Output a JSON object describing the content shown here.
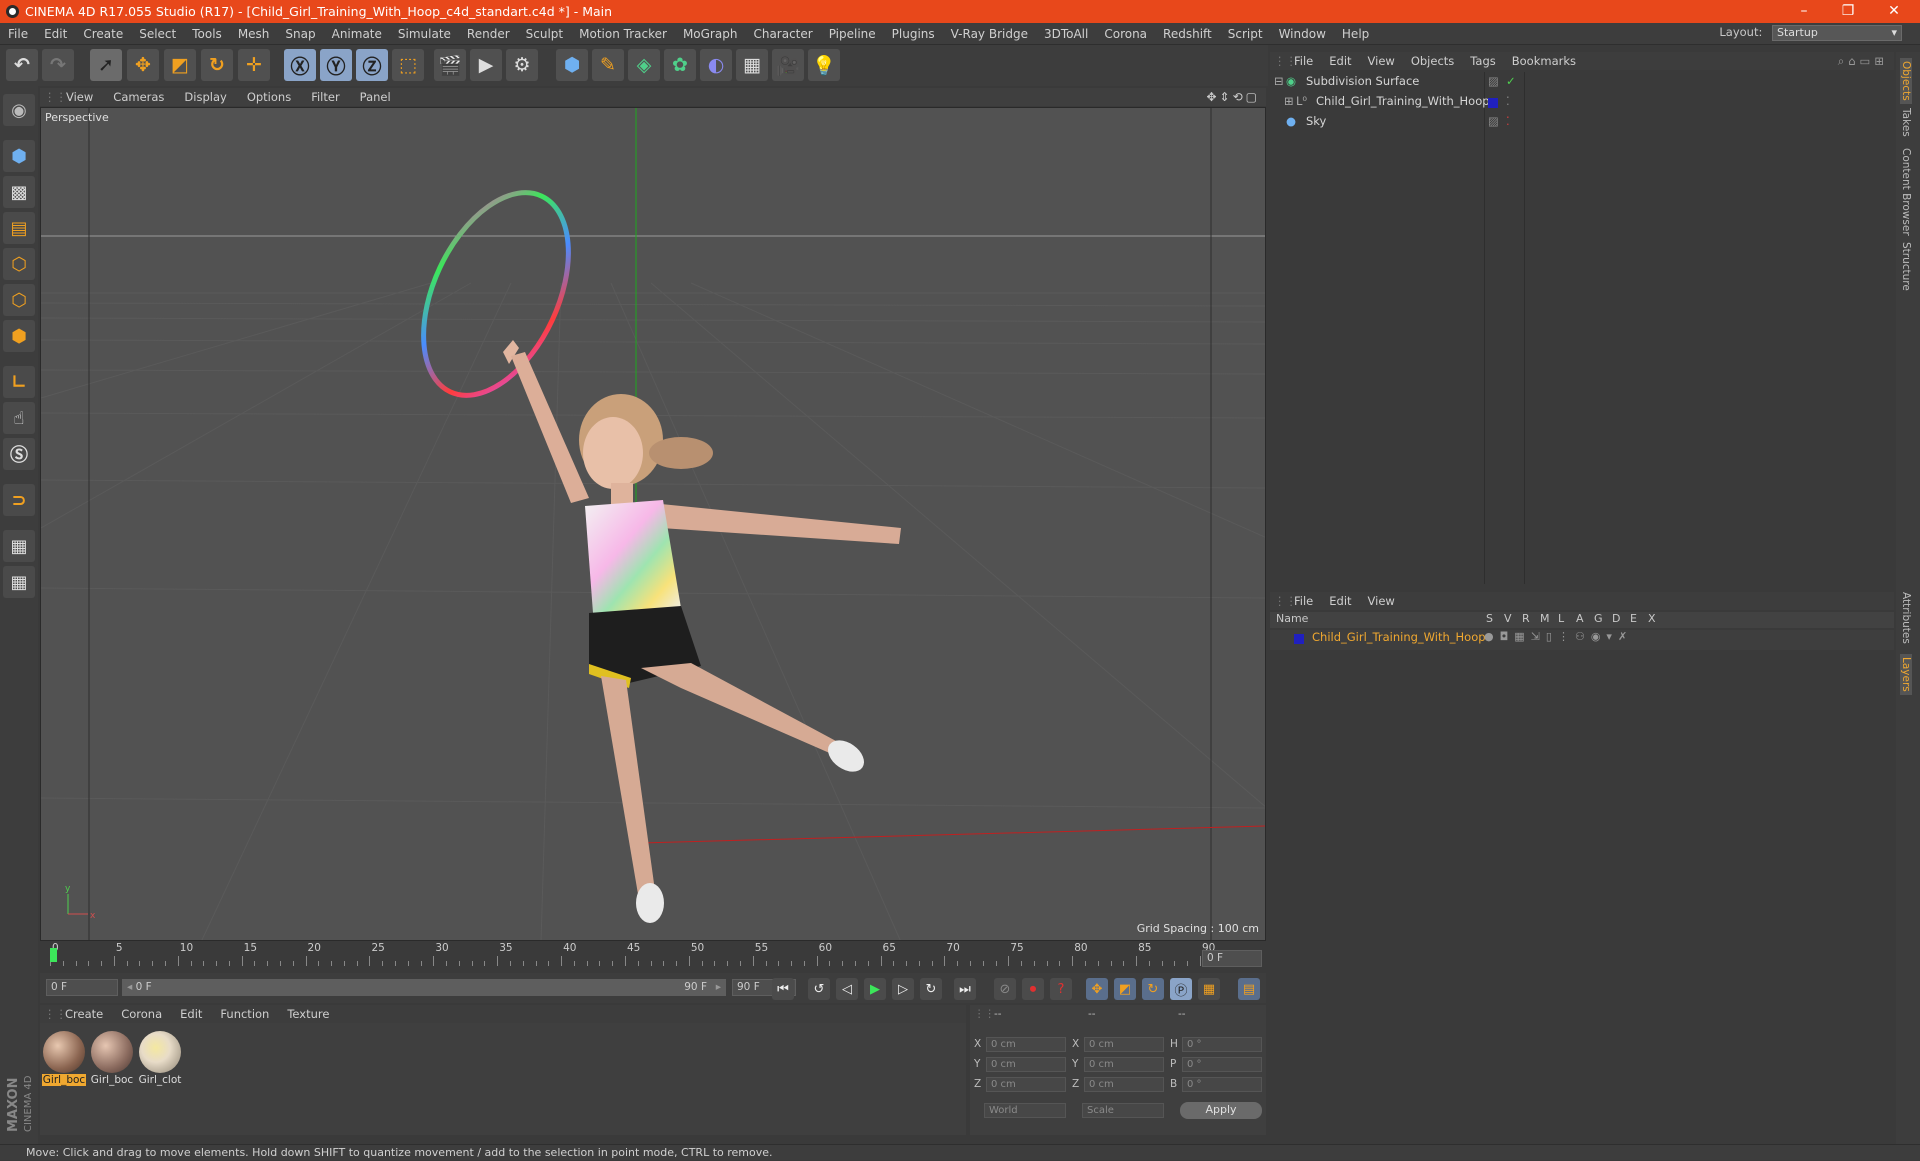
{
  "window": {
    "title": "CINEMA 4D R17.055 Studio (R17) - [Child_Girl_Training_With_Hoop_c4d_standart.c4d *] - Main",
    "controls": [
      "–",
      "❐",
      "✕"
    ]
  },
  "menubar": {
    "items": [
      "File",
      "Edit",
      "Create",
      "Select",
      "Tools",
      "Mesh",
      "Snap",
      "Animate",
      "Simulate",
      "Render",
      "Sculpt",
      "Motion Tracker",
      "MoGraph",
      "Character",
      "Pipeline",
      "Plugins",
      "V-Ray Bridge",
      "3DToAll",
      "Corona",
      "Redshift",
      "Script",
      "Window",
      "Help"
    ],
    "layout_label": "Layout:",
    "layout_value": "Startup"
  },
  "viewport": {
    "menu": [
      "View",
      "Cameras",
      "Display",
      "Options",
      "Filter",
      "Panel"
    ],
    "label": "Perspective",
    "grid_spacing": "Grid Spacing : 100 cm"
  },
  "timeline": {
    "ticks": [
      "0",
      "5",
      "10",
      "15",
      "20",
      "25",
      "30",
      "35",
      "40",
      "45",
      "50",
      "55",
      "60",
      "65",
      "70",
      "75",
      "80",
      "85",
      "90"
    ],
    "current_frame": "0 F"
  },
  "transport": {
    "start": "0 F",
    "range_start": "0 F",
    "range_end": "90 F",
    "end": "90 F"
  },
  "materials": {
    "menu": [
      "Create",
      "Corona",
      "Edit",
      "Function",
      "Texture"
    ],
    "items": [
      {
        "label": "Girl_boc",
        "color": "#a08070",
        "selected": true
      },
      {
        "label": "Girl_boc",
        "color": "#9a7c72",
        "selected": false
      },
      {
        "label": "Girl_clot",
        "color": "#d9d0c0",
        "selected": false
      }
    ]
  },
  "coordinates": {
    "header": [
      "--",
      "--",
      "--"
    ],
    "rows": [
      {
        "a": "X",
        "av": "0 cm",
        "b": "X",
        "bv": "0 cm",
        "c": "H",
        "cv": "0 °"
      },
      {
        "a": "Y",
        "av": "0 cm",
        "b": "Y",
        "bv": "0 cm",
        "c": "P",
        "cv": "0 °"
      },
      {
        "a": "Z",
        "av": "0 cm",
        "b": "Z",
        "bv": "0 cm",
        "c": "B",
        "cv": "0 °"
      }
    ],
    "world": "World",
    "scale": "Scale",
    "apply": "Apply"
  },
  "objects": {
    "menu": [
      "File",
      "Edit",
      "View",
      "Objects",
      "Tags",
      "Bookmarks"
    ],
    "rows": [
      {
        "name": "Subdivision Surface",
        "indent": 0
      },
      {
        "name": "Child_Girl_Training_With_Hoop",
        "indent": 1
      },
      {
        "name": "Sky",
        "indent": 0
      }
    ]
  },
  "layers": {
    "menu": [
      "File",
      "Edit",
      "View"
    ],
    "columns": [
      "Name",
      "S",
      "V",
      "R",
      "M",
      "L",
      "A",
      "G",
      "D",
      "E",
      "X"
    ],
    "rows": [
      {
        "name": "Child_Girl_Training_With_Hoop",
        "color": "#2020c0"
      }
    ]
  },
  "right_tabs": [
    "Objects",
    "Takes",
    "Content Browser",
    "Structure",
    "Attributes",
    "Layers"
  ],
  "status": "Move: Click and drag to move elements. Hold down SHIFT to quantize movement / add to the selection in point mode, CTRL to remove.",
  "colors": {
    "accent": "#e8481b",
    "highlight": "#f0a830"
  }
}
